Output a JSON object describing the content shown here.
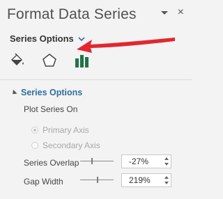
{
  "pane": {
    "title": "Format Data Series",
    "dropdown_icon": "dropdown-triangle-icon",
    "close_label": "×"
  },
  "options_header": {
    "label": "Series Options"
  },
  "tabs": [
    {
      "name": "fill-line",
      "icon": "paint-bucket-icon"
    },
    {
      "name": "effects",
      "icon": "pentagon-icon"
    },
    {
      "name": "series-options",
      "icon": "bar-chart-icon",
      "active": true
    }
  ],
  "colors": {
    "accent": "#2f6f9e",
    "arrow": "#e3262f",
    "bars": "#217346"
  },
  "section": {
    "title": "Series Options",
    "plot_on_label": "Plot Series On",
    "primary_axis": {
      "label": "Primary Axis",
      "checked": true,
      "disabled": true
    },
    "secondary_axis": {
      "label": "Secondary Axis",
      "checked": false,
      "disabled": true
    },
    "series_overlap": {
      "label": "Series Overlap",
      "value": "-27%",
      "level_pct": -27
    },
    "gap_width": {
      "label": "Gap Width",
      "value": "219%",
      "level_pct": 219
    }
  }
}
